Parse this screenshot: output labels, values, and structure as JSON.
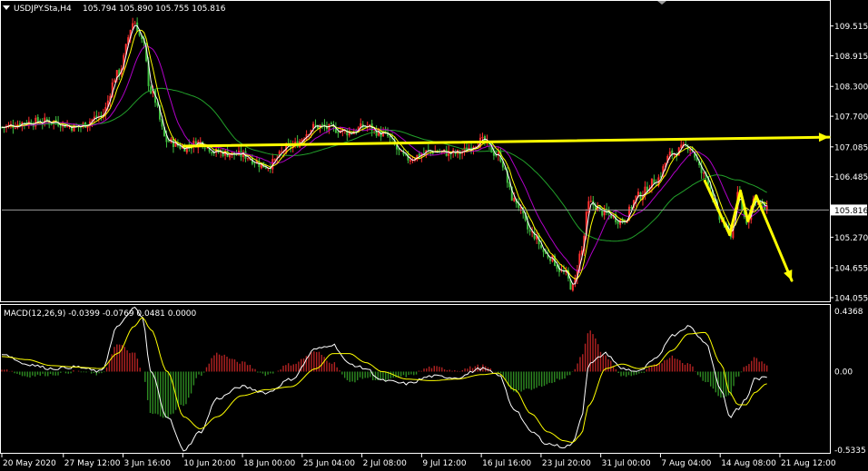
{
  "window": {
    "title": "USDJPY.Sta,H4",
    "ohlc": "105.794 105.890 105.755 105.816"
  },
  "macd": {
    "label": "MACD(12,26,9) -0.0399 -0.0769 0.0481 0.0000"
  },
  "colors": {
    "background": "#000000",
    "frame": "#ffffff",
    "bull_candle": "#ff3030",
    "bear_candle": "#3fbf3f",
    "ma_fast": "#ffffff",
    "ma_mid": "#ffff00",
    "ma_slow": "#b000c8",
    "ma_long": "#22a02a",
    "trendline": "#ffff00",
    "bid_line": "#9a9a9a",
    "hist_up": "#b22222",
    "hist_down": "#2e8b22",
    "macd_line": "#ffffff",
    "signal_line": "#ffff00"
  },
  "chart_data": [
    {
      "type": "candlestick",
      "symbol": "USDJPY.Sta",
      "timeframe": "H4",
      "y_ticks": [
        "109.515",
        "108.915",
        "108.300",
        "107.700",
        "107.085",
        "106.485",
        "105.816",
        "105.270",
        "104.655",
        "104.055"
      ],
      "current_price": "105.816",
      "x_ticks": [
        "20 May 2020",
        "27 May 12:00",
        "3 Jun 16:00",
        "10 Jun 20:00",
        "18 Jun 00:00",
        "25 Jun 04:00",
        "2 Jul 08:00",
        "9 Jul 12:00",
        "16 Jul 16:00",
        "23 Jul 20:00",
        "31 Jul 00:00",
        "7 Aug 04:00",
        "14 Aug 08:00",
        "21 Aug 12:00"
      ],
      "ylim": [
        104.0,
        110.0
      ],
      "xlim": [
        0,
        100
      ],
      "anchors": [
        [
          0,
          107.48
        ],
        [
          3,
          107.58
        ],
        [
          6,
          107.6
        ],
        [
          9,
          107.48
        ],
        [
          12,
          107.7
        ],
        [
          14,
          108.55
        ],
        [
          16,
          109.6
        ],
        [
          17,
          109.2
        ],
        [
          18,
          108.2
        ],
        [
          20,
          107.2
        ],
        [
          22,
          107.08
        ],
        [
          24,
          107.18
        ],
        [
          26,
          106.98
        ],
        [
          29,
          106.92
        ],
        [
          32,
          106.7
        ],
        [
          35,
          107.1
        ],
        [
          38,
          107.5
        ],
        [
          40,
          107.45
        ],
        [
          42,
          107.38
        ],
        [
          44,
          107.5
        ],
        [
          46,
          107.35
        ],
        [
          49,
          106.85
        ],
        [
          52,
          107.0
        ],
        [
          55,
          106.95
        ],
        [
          58,
          107.2
        ],
        [
          60,
          106.92
        ],
        [
          62,
          106.0
        ],
        [
          64,
          105.35
        ],
        [
          66,
          104.9
        ],
        [
          68,
          104.55
        ],
        [
          69,
          104.25
        ],
        [
          70,
          104.95
        ],
        [
          71,
          105.95
        ],
        [
          73,
          105.75
        ],
        [
          75,
          105.6
        ],
        [
          77,
          106.1
        ],
        [
          79,
          106.4
        ],
        [
          81,
          106.95
        ],
        [
          83,
          107.1
        ],
        [
          85,
          106.5
        ],
        [
          87,
          105.6
        ],
        [
          88,
          105.3
        ],
        [
          89,
          106.1
        ],
        [
          90,
          105.6
        ],
        [
          91,
          106.05
        ],
        [
          92.5,
          105.82
        ]
      ],
      "trendlines": [
        {
          "from": [
            22,
            107.1
          ],
          "to": [
            100,
            107.28
          ]
        },
        {
          "from": [
            85,
            106.4
          ],
          "to": [
            88,
            105.32
          ]
        },
        {
          "from": [
            88,
            105.32
          ],
          "to": [
            89.3,
            106.2
          ]
        },
        {
          "from": [
            89.3,
            106.2
          ],
          "to": [
            90.2,
            105.6
          ]
        },
        {
          "from": [
            90.2,
            105.6
          ],
          "to": [
            91.2,
            106.1
          ]
        },
        {
          "from": [
            91.2,
            106.1
          ],
          "to": [
            95.5,
            104.4
          ]
        }
      ]
    },
    {
      "type": "bar",
      "name": "MACD(12,26,9)",
      "y_ticks": [
        "0.4368",
        "0.00",
        "-0.5335"
      ],
      "ylim": [
        -0.5335,
        0.4368
      ],
      "macd_anchors": [
        [
          0,
          0.12
        ],
        [
          3,
          0.05
        ],
        [
          6,
          0.02
        ],
        [
          9,
          0.03
        ],
        [
          12,
          0.0
        ],
        [
          14,
          0.3
        ],
        [
          16,
          0.42
        ],
        [
          17,
          0.36
        ],
        [
          18,
          0.0
        ],
        [
          20,
          -0.3
        ],
        [
          22,
          -0.52
        ],
        [
          24,
          -0.4
        ],
        [
          26,
          -0.18
        ],
        [
          29,
          -0.1
        ],
        [
          32,
          -0.14
        ],
        [
          35,
          -0.05
        ],
        [
          38,
          0.15
        ],
        [
          40,
          0.18
        ],
        [
          42,
          0.05
        ],
        [
          44,
          0.02
        ],
        [
          46,
          -0.06
        ],
        [
          49,
          -0.08
        ],
        [
          52,
          -0.03
        ],
        [
          55,
          -0.04
        ],
        [
          58,
          0.02
        ],
        [
          60,
          -0.02
        ],
        [
          62,
          -0.25
        ],
        [
          64,
          -0.4
        ],
        [
          66,
          -0.48
        ],
        [
          68,
          -0.5
        ],
        [
          69,
          -0.48
        ],
        [
          70,
          -0.32
        ],
        [
          71,
          0.05
        ],
        [
          73,
          0.12
        ],
        [
          75,
          0.02
        ],
        [
          77,
          0.0
        ],
        [
          79,
          0.08
        ],
        [
          81,
          0.24
        ],
        [
          83,
          0.3
        ],
        [
          85,
          0.2
        ],
        [
          87,
          -0.12
        ],
        [
          88,
          -0.3
        ],
        [
          89,
          -0.25
        ],
        [
          90,
          -0.18
        ],
        [
          91,
          -0.05
        ],
        [
          92.5,
          -0.04
        ]
      ],
      "signal_anchors": [
        [
          0,
          0.1
        ],
        [
          3,
          0.08
        ],
        [
          6,
          0.04
        ],
        [
          9,
          0.03
        ],
        [
          12,
          0.02
        ],
        [
          14,
          0.12
        ],
        [
          16,
          0.3
        ],
        [
          17,
          0.36
        ],
        [
          18,
          0.28
        ],
        [
          20,
          0.0
        ],
        [
          22,
          -0.3
        ],
        [
          24,
          -0.38
        ],
        [
          26,
          -0.3
        ],
        [
          29,
          -0.16
        ],
        [
          32,
          -0.12
        ],
        [
          35,
          -0.1
        ],
        [
          38,
          0.02
        ],
        [
          40,
          0.12
        ],
        [
          42,
          0.12
        ],
        [
          44,
          0.06
        ],
        [
          46,
          0.0
        ],
        [
          49,
          -0.05
        ],
        [
          52,
          -0.06
        ],
        [
          55,
          -0.05
        ],
        [
          58,
          -0.02
        ],
        [
          60,
          -0.01
        ],
        [
          62,
          -0.12
        ],
        [
          64,
          -0.28
        ],
        [
          66,
          -0.4
        ],
        [
          68,
          -0.46
        ],
        [
          69,
          -0.47
        ],
        [
          70,
          -0.42
        ],
        [
          71,
          -0.22
        ],
        [
          73,
          0.02
        ],
        [
          75,
          0.05
        ],
        [
          77,
          0.02
        ],
        [
          79,
          0.04
        ],
        [
          81,
          0.14
        ],
        [
          83,
          0.25
        ],
        [
          85,
          0.26
        ],
        [
          87,
          0.05
        ],
        [
          88,
          -0.14
        ],
        [
          89,
          -0.22
        ],
        [
          90,
          -0.22
        ],
        [
          91,
          -0.14
        ],
        [
          92.5,
          -0.08
        ]
      ]
    }
  ]
}
